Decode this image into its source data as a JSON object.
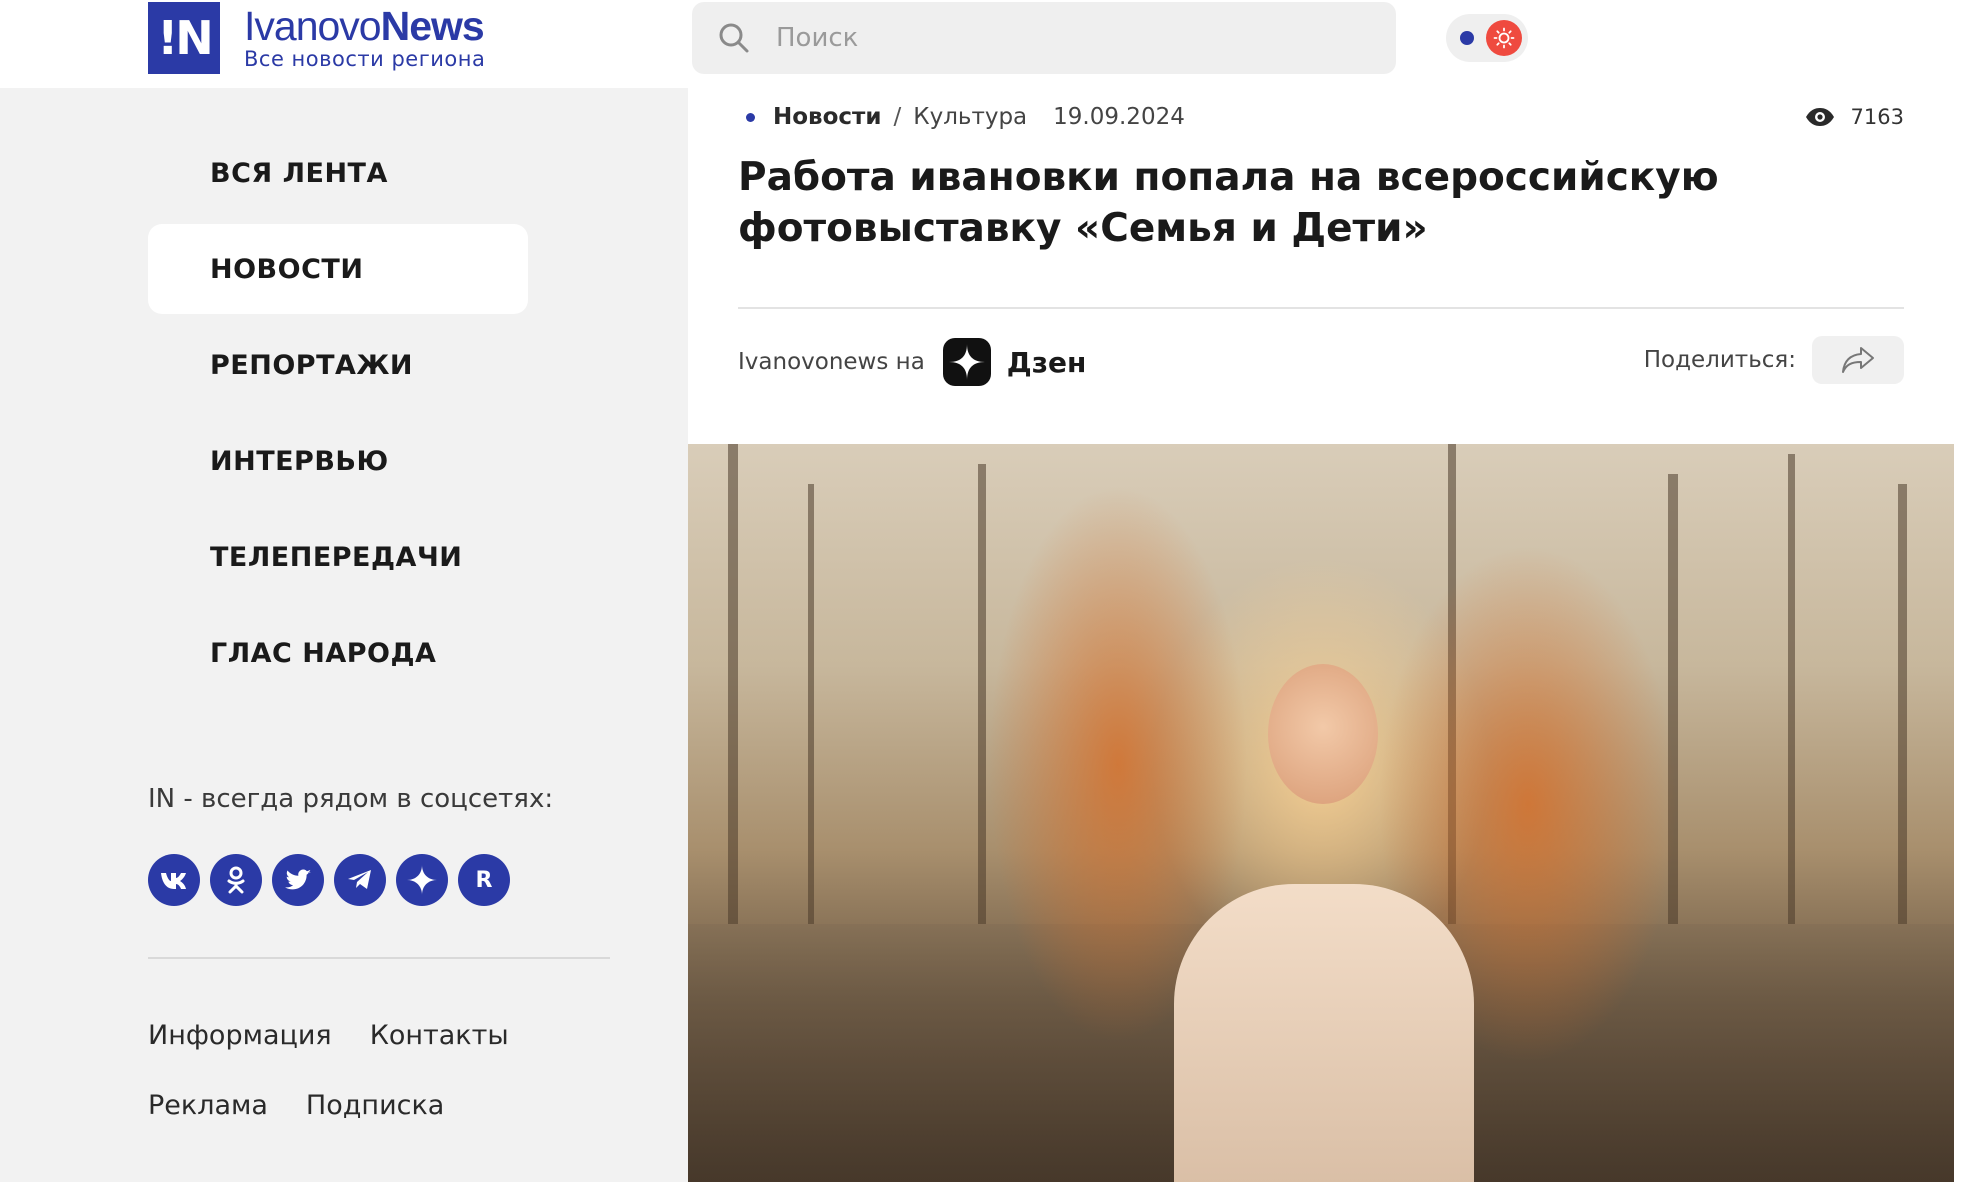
{
  "header": {
    "logo_mark": "!N",
    "logo_name_light": "Ivanovo",
    "logo_name_bold": "News",
    "logo_tagline": "Все новости региона",
    "search_placeholder": "Поиск"
  },
  "colors": {
    "brand": "#2b3aa6",
    "sun_toggle": "#ef4a3f",
    "sidebar_bg": "#f2f2f2"
  },
  "sidebar": {
    "nav": [
      {
        "label": "ВСЯ ЛЕНТА",
        "active": false
      },
      {
        "label": "НОВОСТИ",
        "active": true
      },
      {
        "label": "РЕПОРТАЖИ",
        "active": false
      },
      {
        "label": "ИНТЕРВЬЮ",
        "active": false
      },
      {
        "label": "ТЕЛЕПЕРЕДАЧИ",
        "active": false
      },
      {
        "label": "ГЛАС НАРОДА",
        "active": false
      }
    ],
    "social_title": "IN - всегда рядом в соцсетях:",
    "social_icons": [
      "vk-icon",
      "odnoklassniki-icon",
      "twitter-icon",
      "telegram-icon",
      "dzen-icon",
      "rutube-icon"
    ],
    "social_rutube_letter": "R",
    "footer_links": {
      "info": "Информация",
      "contacts": "Контакты",
      "ads": "Реклама",
      "subscribe": "Подписка"
    }
  },
  "article": {
    "breadcrumb_section": "Новости",
    "breadcrumb_sep": "/",
    "breadcrumb_category": "Культура",
    "date": "19.09.2024",
    "views": "7163",
    "headline": "Работа ивановки попала на всероссийскую фотовыставку «Семья и Дети»",
    "dzen_prefix": "Ivanovonews на",
    "dzen_name": "Дзен",
    "share_label": "Поделиться:"
  }
}
